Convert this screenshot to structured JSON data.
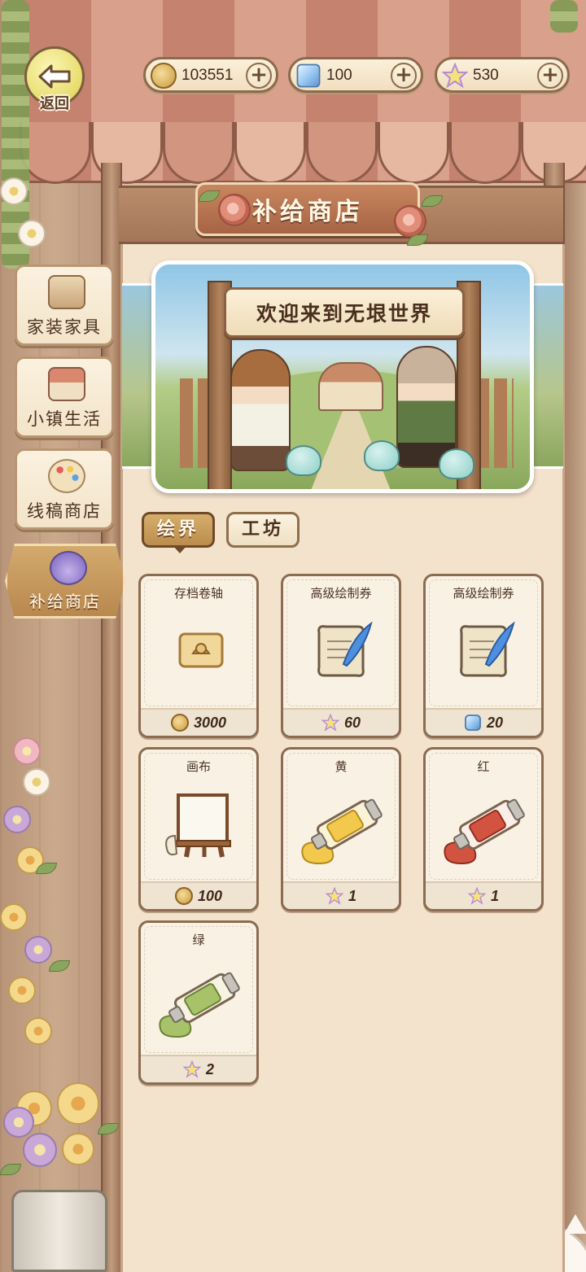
{
  "header": {
    "back_label": "返回",
    "shop_title": "补给商店"
  },
  "currencies": [
    {
      "icon": "gold-coin-icon",
      "value": "103551"
    },
    {
      "icon": "ice-cube-gem-icon",
      "value": "100"
    },
    {
      "icon": "rainbow-star-icon",
      "value": "530"
    }
  ],
  "sidebar": {
    "items": [
      {
        "label": "家装家具",
        "icon": "furniture-shelf-icon"
      },
      {
        "label": "小镇生活",
        "icon": "town-house-icon"
      },
      {
        "label": "线稿商店",
        "icon": "paint-palette-icon"
      },
      {
        "label": "补给商店",
        "icon": "potion-bottle-icon",
        "active": true
      }
    ]
  },
  "banner": {
    "headline": "欢迎来到无垠世界"
  },
  "category_tabs": [
    {
      "label": "绘界",
      "active": true
    },
    {
      "label": "工坊",
      "active": false
    }
  ],
  "items": [
    {
      "name": "存档卷轴",
      "icon": "save-scroll-icon",
      "price": "3000",
      "currency": "gold-coin-icon"
    },
    {
      "name": "高级绘制券",
      "icon": "quill-scroll-icon",
      "price": "60",
      "currency": "rainbow-star-icon"
    },
    {
      "name": "高级绘制券",
      "icon": "quill-scroll-icon",
      "price": "20",
      "currency": "ice-cube-gem-icon"
    },
    {
      "name": "画布",
      "icon": "easel-canvas-icon",
      "price": "100",
      "currency": "gold-coin-icon"
    },
    {
      "name": "黄",
      "icon": "yellow-paint-tube-icon",
      "price": "1",
      "currency": "rainbow-star-icon"
    },
    {
      "name": "红",
      "icon": "red-paint-tube-icon",
      "price": "1",
      "currency": "rainbow-star-icon"
    },
    {
      "name": "绿",
      "icon": "green-paint-tube-icon",
      "price": "2",
      "currency": "rainbow-star-icon"
    }
  ],
  "colors": {
    "panel_bg": "#f3e3cd",
    "accent_gold": "#bc8d4d",
    "card_border": "#8b6b51",
    "paint_yellow": "#f2c94c",
    "paint_red": "#d2533f",
    "paint_green": "#a8c26a"
  }
}
